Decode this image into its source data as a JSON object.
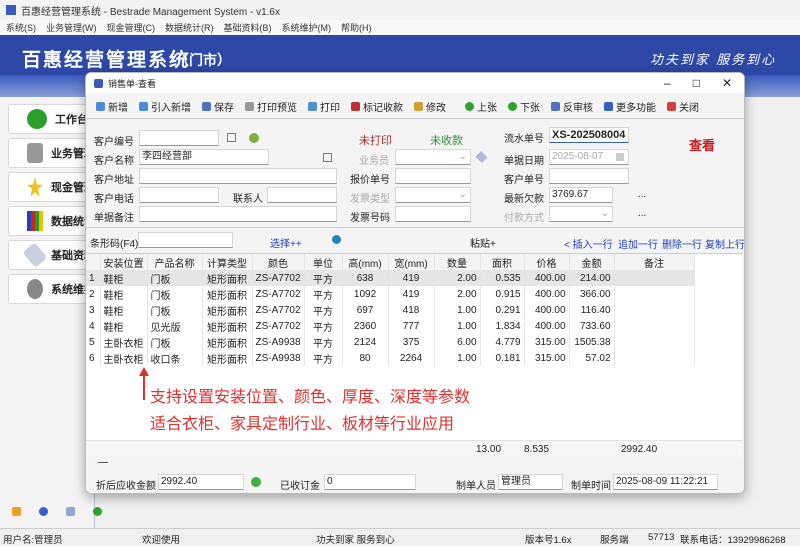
{
  "app": {
    "title": "百惠经营管理系统 - Bestrade Management System - v1.6x",
    "menu": [
      "系统(S)",
      "业务管理(W)",
      "现金管理(C)",
      "数据统计(R)",
      "基础资料(B)",
      "系统维护(M)",
      "帮助(H)"
    ],
    "header_title": "百惠经营管理系统",
    "header_sub": "（门市）",
    "slogan": "功夫到家 服务到心"
  },
  "left_nav": [
    {
      "label": "工作台",
      "icon": "check-icon"
    },
    {
      "label": "业务管理",
      "icon": "printer-icon"
    },
    {
      "label": "现金管理",
      "icon": "star-icon"
    },
    {
      "label": "数据统计",
      "icon": "bar-chart-icon"
    },
    {
      "label": "基础资料",
      "icon": "tag-icon"
    },
    {
      "label": "系统维护",
      "icon": "gear-icon"
    }
  ],
  "dialog": {
    "title": "销售单-查看",
    "toolbar": [
      "新增",
      "引入新增",
      "保存",
      "打印预览",
      "打印",
      "标记收款",
      "修改",
      "上张",
      "下张",
      "反审核",
      "更多功能",
      "关闭"
    ],
    "form": {
      "customer_no_label": "客户编号",
      "customer_no": "",
      "customer_name_label": "客户名称",
      "customer_name": "李四经营部",
      "address_label": "客户地址",
      "phone_label": "客户电话",
      "contact_label": "联系人",
      "remark_label": "单据备注",
      "print_status": "未打印",
      "pay_status": "未收款",
      "salesman_label": "业务员",
      "quote_no_label": "报价单号",
      "invoice_type_label": "发票类型",
      "invoice_no_label": "发票号码",
      "serial_label": "流水单号",
      "serial": "XS-202508004",
      "date_label": "单据日期",
      "date": "2025-08-07",
      "cust_order_label": "客户单号",
      "debt_label": "最新欠款",
      "debt": "3769.67",
      "pay_method_label": "付款方式",
      "mode": "查看"
    },
    "barcode_label": "条形码(F4)",
    "select_link": "选择++",
    "paste_label": "粘贴+",
    "row_actions": [
      "< 插入一行",
      "追加一行",
      "删除一行",
      "复制上行"
    ],
    "columns": [
      "安装位置",
      "产品名称",
      "计算类型",
      "颜色",
      "单位",
      "高(mm)",
      "宽(mm)",
      "数量",
      "面积",
      "价格",
      "金额",
      "备注"
    ],
    "rows": [
      [
        "1",
        "鞋柜",
        "门板",
        "矩形面积",
        "ZS-A7702",
        "平方",
        "638",
        "419",
        "2.00",
        "0.535",
        "400.00",
        "214.00",
        ""
      ],
      [
        "2",
        "鞋柜",
        "门板",
        "矩形面积",
        "ZS-A7702",
        "平方",
        "1092",
        "419",
        "2.00",
        "0.915",
        "400.00",
        "366.00",
        ""
      ],
      [
        "3",
        "鞋柜",
        "门板",
        "矩形面积",
        "ZS-A7702",
        "平方",
        "697",
        "418",
        "1.00",
        "0.291",
        "400.00",
        "116.40",
        ""
      ],
      [
        "4",
        "鞋柜",
        "见光版",
        "矩形面积",
        "ZS-A7702",
        "平方",
        "2360",
        "777",
        "1.00",
        "1.834",
        "400.00",
        "733.60",
        ""
      ],
      [
        "5",
        "主卧衣柜",
        "门板",
        "矩形面积",
        "ZS-A9938",
        "平方",
        "2124",
        "375",
        "6.00",
        "4.779",
        "315.00",
        "1505.38",
        ""
      ],
      [
        "6",
        "主卧衣柜",
        "收口条",
        "矩形面积",
        "ZS-A9938",
        "平方",
        "80",
        "2264",
        "1.00",
        "0.181",
        "315.00",
        "57.02",
        ""
      ]
    ],
    "totals": {
      "qty": "13.00",
      "area": "8.535",
      "amount": "2992.40"
    },
    "footer": {
      "due_label": "折后应收金额",
      "due": "2992.40",
      "deposit_label": "已收订金",
      "deposit": "0",
      "maker_label": "制单人员",
      "maker": "管理员",
      "time_label": "制单时间",
      "time": "2025-08-09 11:22:21"
    }
  },
  "annotation": [
    "支持设置安装位置、颜色、厚度、深度等参数",
    "适合衣柜、家具定制行业、板材等行业应用"
  ],
  "status": {
    "user": "用户名:管理员",
    "welcome": "欢迎使用",
    "slogan": "功夫到家 服务到心",
    "version": "版本号1.6x",
    "server": "服务端",
    "port": "57713",
    "phone": "联系电话：13929986268"
  }
}
